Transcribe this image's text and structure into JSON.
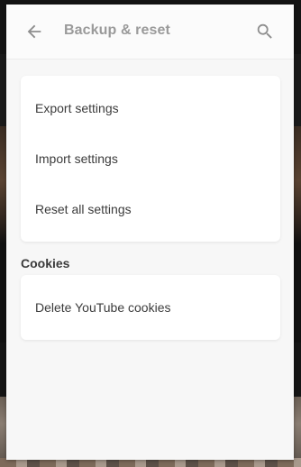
{
  "header": {
    "title": "Backup & reset",
    "back_icon": "arrow-left-icon",
    "search_icon": "search-icon"
  },
  "general": {
    "items": [
      {
        "label": "Export settings"
      },
      {
        "label": "Import settings"
      },
      {
        "label": "Reset all settings"
      }
    ]
  },
  "cookies": {
    "section_title": "Cookies",
    "items": [
      {
        "label": "Delete YouTube cookies"
      }
    ]
  },
  "colors": {
    "panel_background": "#f7f7f7",
    "card_background": "#ffffff",
    "title_color": "#9a9a9a",
    "text_color": "#3c3c3c"
  }
}
